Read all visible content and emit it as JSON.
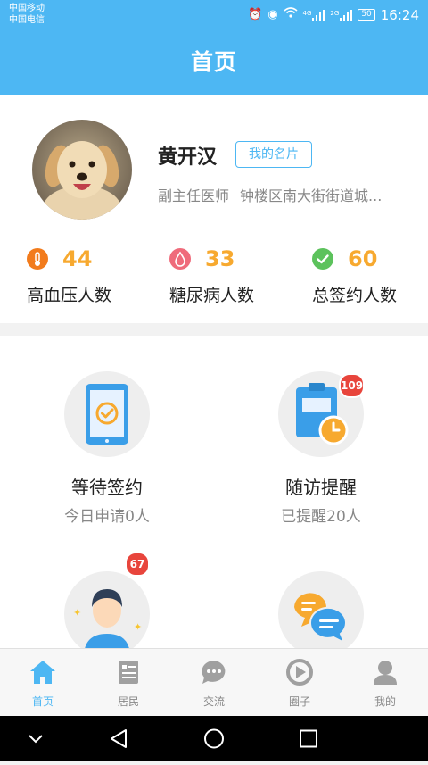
{
  "status": {
    "carrier1": "中国移动",
    "carrier2": "中国电信",
    "net1": "4G",
    "net2": "2G",
    "battery": "50",
    "time": "16:24"
  },
  "header": {
    "title": "首页"
  },
  "profile": {
    "name": "黄开汉",
    "card_button": "我的名片",
    "role": "副主任医师",
    "address": "钟楼区南大街街道城..."
  },
  "stats": [
    {
      "value": "44",
      "label": "高血压人数",
      "icon": "thermometer-icon",
      "color": "#f27b1c"
    },
    {
      "value": "33",
      "label": "糖尿病人数",
      "icon": "blood-drop-icon",
      "color": "#ef6b7b"
    },
    {
      "value": "60",
      "label": "总签约人数",
      "icon": "check-icon",
      "color": "#5cc25c"
    }
  ],
  "tiles": [
    {
      "title": "等待签约",
      "subtitle": "今日申请0人",
      "icon": "tablet-check-icon"
    },
    {
      "title": "随访提醒",
      "subtitle": "已提醒20人",
      "icon": "clipboard-clock-icon",
      "badge": "109"
    },
    {
      "title": "",
      "subtitle": "",
      "icon": "resident-person-icon",
      "badge": "67"
    },
    {
      "title": "",
      "subtitle": "",
      "icon": "chat-bubbles-icon"
    }
  ],
  "tabs": [
    {
      "label": "首页",
      "icon": "home-icon",
      "active": true
    },
    {
      "label": "居民",
      "icon": "resident-list-icon"
    },
    {
      "label": "交流",
      "icon": "chat-icon"
    },
    {
      "label": "圈子",
      "icon": "circle-play-icon"
    },
    {
      "label": "我的",
      "icon": "user-icon"
    }
  ],
  "colors": {
    "primary": "#4db7f3",
    "accent_number": "#f7a92f",
    "badge": "#e8453c"
  }
}
